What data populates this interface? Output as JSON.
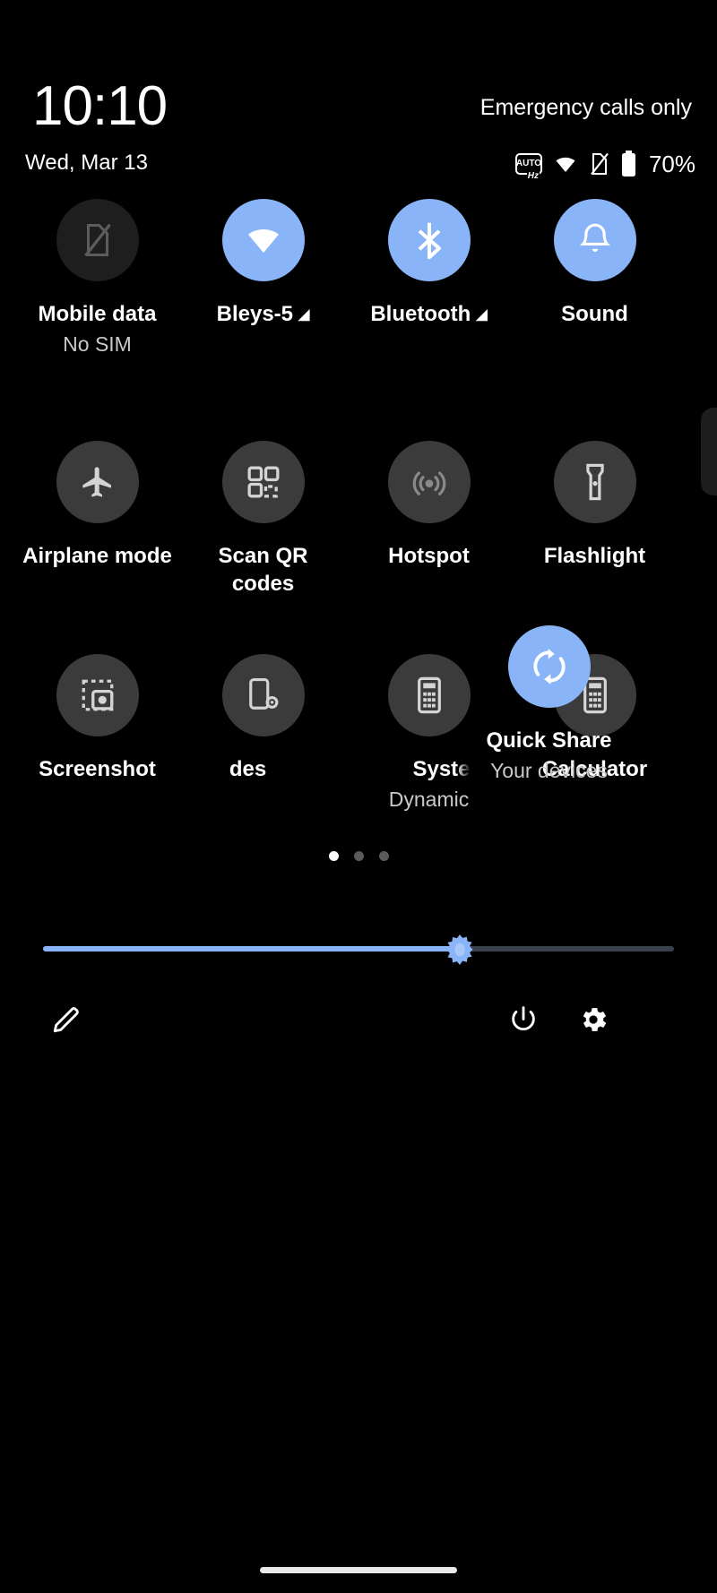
{
  "statusbar": {
    "time": "10:10",
    "carrier_status": "Emergency calls only",
    "date": "Wed, Mar 13",
    "battery_percent": "70%",
    "refresh_rate_auto": "AUTO",
    "refresh_rate_unit": "Hz",
    "icons": [
      "refresh-rate-auto-icon",
      "wifi-icon",
      "no-sim-icon",
      "battery-icon"
    ]
  },
  "accent_color": "#8ab4f8",
  "tile_off_color": "#3b3b3b",
  "tiles": [
    {
      "name": "mobile-data",
      "label": "Mobile data",
      "sublabel": "No SIM",
      "state": "off",
      "icon": "no-sim-icon",
      "has_caret": false
    },
    {
      "name": "wifi",
      "label": "Bleys-5",
      "sublabel": "",
      "state": "on",
      "icon": "wifi-icon",
      "has_caret": true
    },
    {
      "name": "bluetooth",
      "label": "Bluetooth",
      "sublabel": "",
      "state": "on",
      "icon": "bluetooth-icon",
      "has_caret": true
    },
    {
      "name": "sound",
      "label": "Sound",
      "sublabel": "",
      "state": "on",
      "icon": "bell-icon",
      "has_caret": false
    },
    {
      "name": "airplane-mode",
      "label": "Airplane mode",
      "sublabel": "",
      "state": "dim",
      "icon": "airplane-icon",
      "has_caret": false
    },
    {
      "name": "scan-qr-codes",
      "label": "Scan QR codes",
      "sublabel": "",
      "state": "dim",
      "icon": "qr-code-icon",
      "has_caret": false
    },
    {
      "name": "hotspot",
      "label": "Hotspot",
      "sublabel": "",
      "state": "dim",
      "icon": "hotspot-icon",
      "has_caret": false
    },
    {
      "name": "flashlight",
      "label": "Flashlight",
      "sublabel": "",
      "state": "dim",
      "icon": "flashlight-icon",
      "has_caret": false
    },
    {
      "name": "screenshot",
      "label": "Screenshot",
      "sublabel": "",
      "state": "dim",
      "icon": "screenshot-icon",
      "has_caret": false
    },
    {
      "name": "partial-tile-left",
      "label": "des",
      "sublabel": "",
      "state": "dim",
      "icon": "phone-settings-icon",
      "has_caret": false
    },
    {
      "name": "system-partial-tile",
      "label": "Syste",
      "sublabel": "Dynamic",
      "state": "dim",
      "icon": "calculator-icon",
      "has_caret": false
    },
    {
      "name": "calculator",
      "label": "Calculator",
      "sublabel": "",
      "state": "dim",
      "icon": "calculator-icon",
      "has_caret": false
    },
    {
      "name": "quick-share",
      "label": "Quick Share",
      "sublabel": "Your devices",
      "state": "on",
      "icon": "quick-share-icon",
      "has_caret": false
    }
  ],
  "pager": {
    "total_pages": 3,
    "current_page": 1
  },
  "brightness": {
    "value_percent": 66,
    "icon": "brightness-sun-icon"
  },
  "footer_actions": [
    {
      "name": "edit-tiles-button",
      "icon": "pencil-icon"
    },
    {
      "name": "power-button",
      "icon": "power-icon"
    },
    {
      "name": "settings-button",
      "icon": "gear-icon"
    }
  ]
}
